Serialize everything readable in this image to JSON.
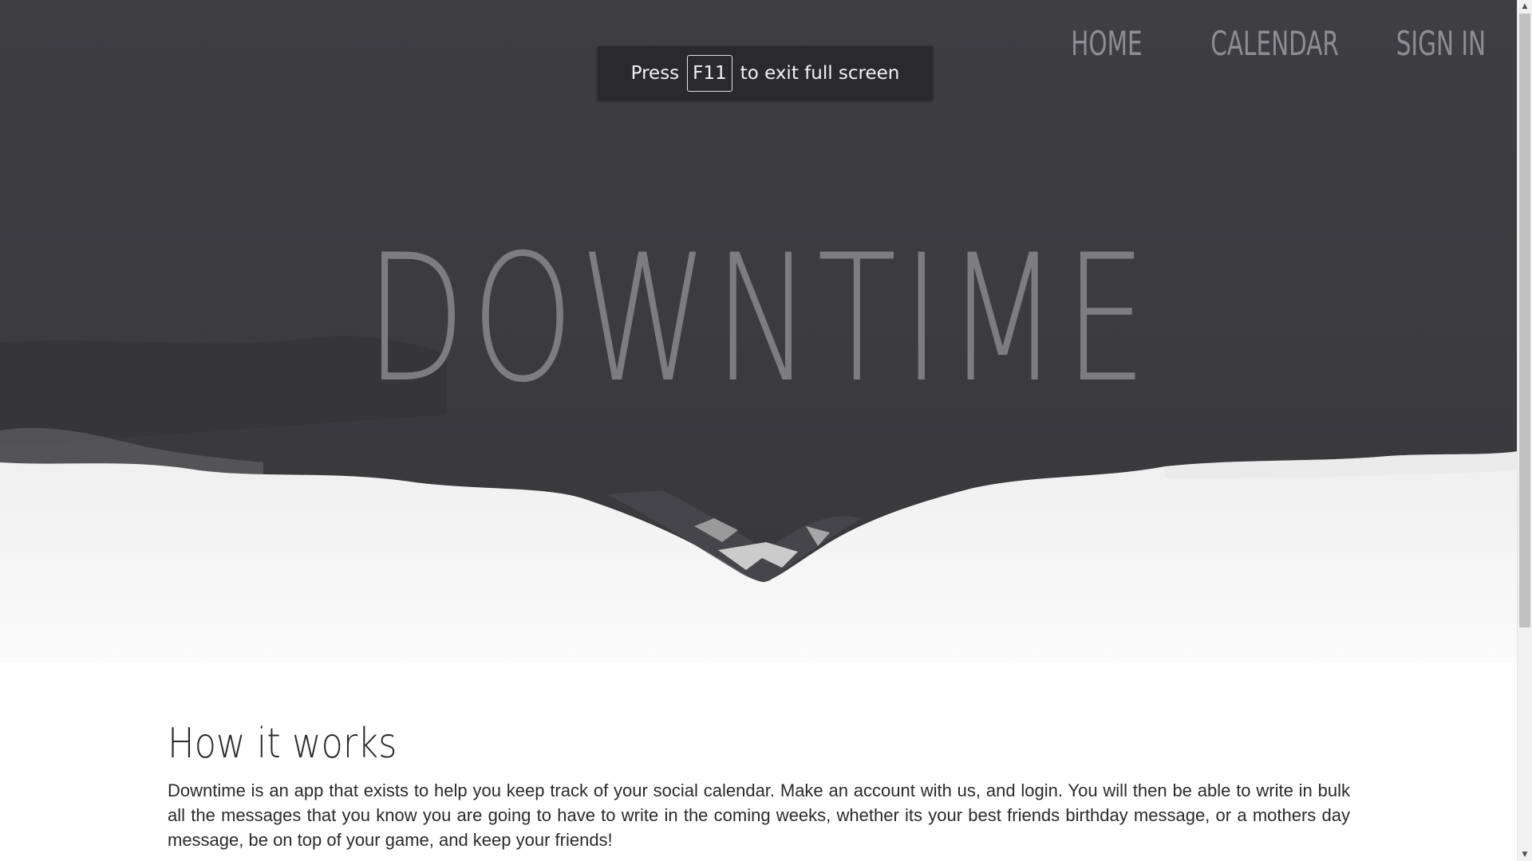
{
  "nav": {
    "items": [
      {
        "label": "HOME"
      },
      {
        "label": "CALENDAR"
      },
      {
        "label": "SIGN IN"
      }
    ]
  },
  "fullscreen_toast": {
    "prefix": "Press",
    "key": "F11",
    "suffix": "to exit full screen"
  },
  "hero": {
    "title": "DOWNTIME"
  },
  "how_it_works": {
    "heading": "How it works",
    "body": "Downtime is an app that exists to help you keep track of your social calendar. Make an account with us, and login. You will then be able to write in bulk all the messages that you know you are going to have to write in the coming weeks, whether its your best friends birthday message, or a mothers day message, be on top of your game, and keep your friends!"
  },
  "colors": {
    "hero_background": "#3d3d40",
    "hero_title": "#7d7d80",
    "nav_text": "#8e8e92",
    "toast_background": "#2a2a2d",
    "body_text": "#2a2a2a"
  },
  "icons": {
    "scroll_up": "triangle-up-icon",
    "scroll_down": "triangle-down-icon"
  }
}
